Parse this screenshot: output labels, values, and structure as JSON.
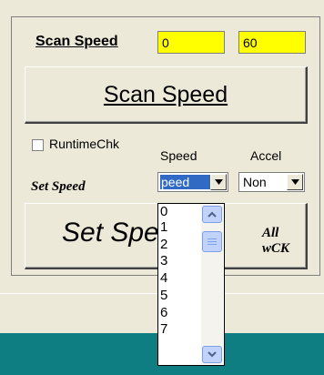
{
  "scan": {
    "label": "Scan Speed",
    "from_value": "0",
    "to_value": "60",
    "button_label": "Scan Speed",
    "input_color": "#ffff00"
  },
  "runtime_check": {
    "label": "RuntimeChk",
    "checked": false
  },
  "columns": {
    "speed": "Speed",
    "accel": "Accel"
  },
  "set_speed": {
    "label": "Set Speed",
    "speed_value": "Speed",
    "speed_value_shown": "peed",
    "accel_value": "Non",
    "button_label": "Set Spe",
    "all_wck": "All wCK"
  },
  "dropdown": {
    "items": [
      "0",
      "1",
      "2",
      "3",
      "4",
      "5",
      "6",
      "7"
    ],
    "selection_color": "#316ac5"
  },
  "colors": {
    "teal_bar": "#0f7e83",
    "face": "#ece9d8"
  },
  "icons": {
    "combo_arrow": "chevron-down-icon",
    "scroll_up": "chevron-up-icon",
    "scroll_down": "chevron-down-icon"
  }
}
